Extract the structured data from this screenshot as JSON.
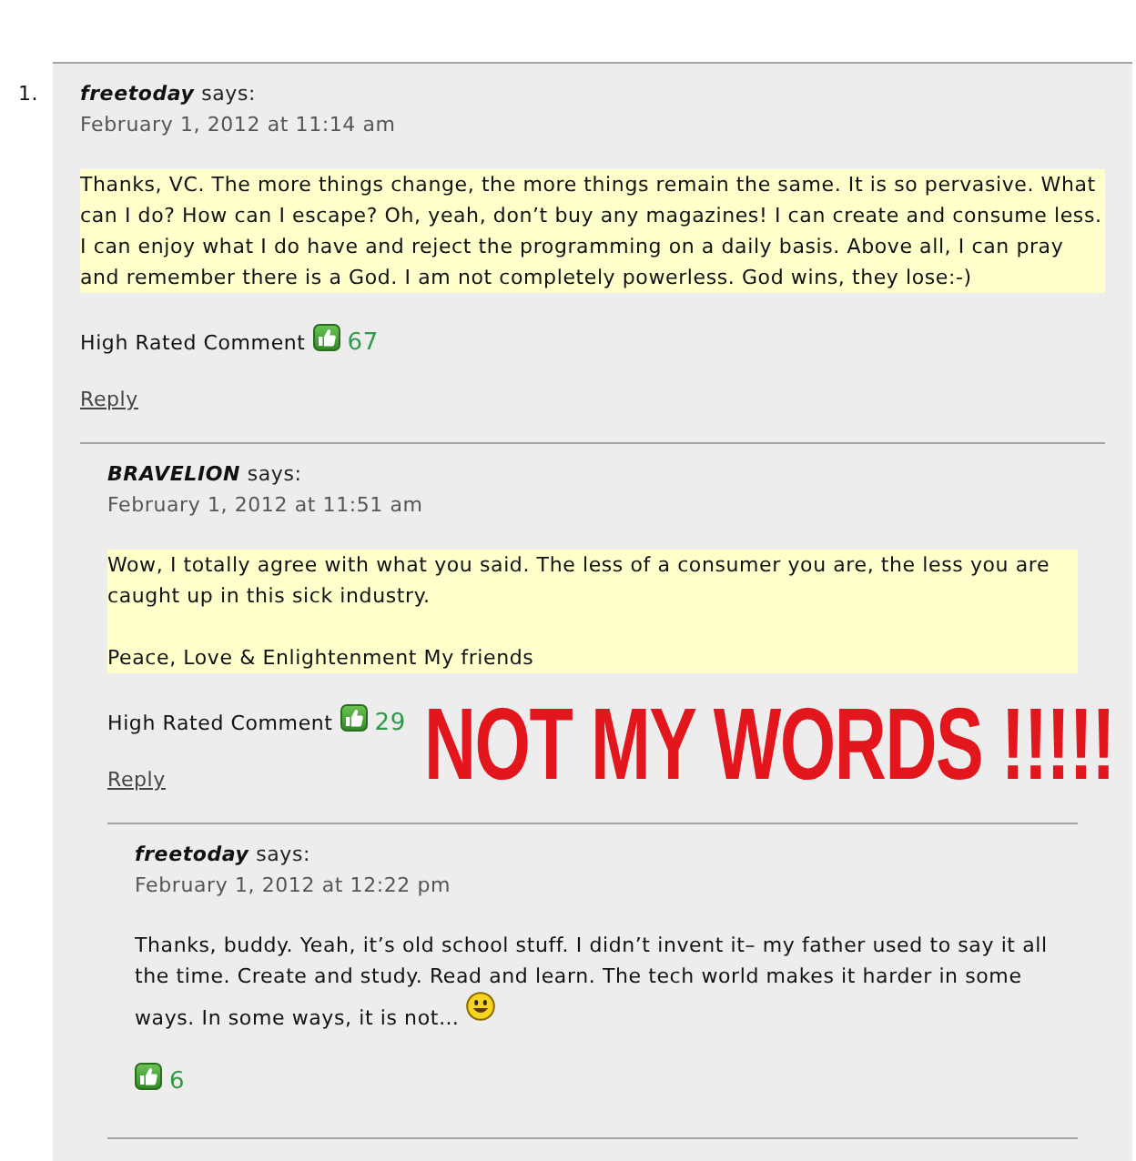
{
  "comments": [
    {
      "number": "1.",
      "author": "freetoday",
      "says": "says:",
      "date": "February 1, 2012 at 11:14 am",
      "highlighted": true,
      "smiley": false,
      "paragraphs": [
        "Thanks, VC. The more things change, the more things remain the same. It is so pervasive. What can I do? How can I escape? Oh, yeah, don’t buy any magazines! I can create and consume less. I can enjoy what I do have and reject the programming on a daily basis. Above all, I can pray and remember there is a God. I am not completely powerless. God wins, they lose:-)"
      ],
      "rating_label": "High Rated Comment",
      "votes": "67",
      "reply": "Reply",
      "children": [
        {
          "author": "BRAVELION",
          "says": "says:",
          "date": "February 1, 2012 at 11:51 am",
          "highlighted": true,
          "smiley": false,
          "paragraphs": [
            "Wow, I totally agree with what you said. The less of a consumer you are, the less you are caught up in this sick industry.",
            "Peace, Love & Enlightenment My friends"
          ],
          "rating_label": "High Rated Comment",
          "votes": "29",
          "reply": "Reply",
          "children": [
            {
              "author": "freetoday",
              "says": "says:",
              "date": "February 1, 2012 at 12:22 pm",
              "highlighted": false,
              "smiley": true,
              "paragraphs": [
                "Thanks, buddy. Yeah, it’s old school stuff. I didn’t invent it– my father used to say it all the time. Create and study. Read and learn. The tech world makes it harder in some ways. In some ways, it is not…"
              ],
              "votes": "6"
            }
          ]
        }
      ]
    }
  ],
  "annotation": {
    "text": "NOT MY WORDS !!!!!"
  }
}
